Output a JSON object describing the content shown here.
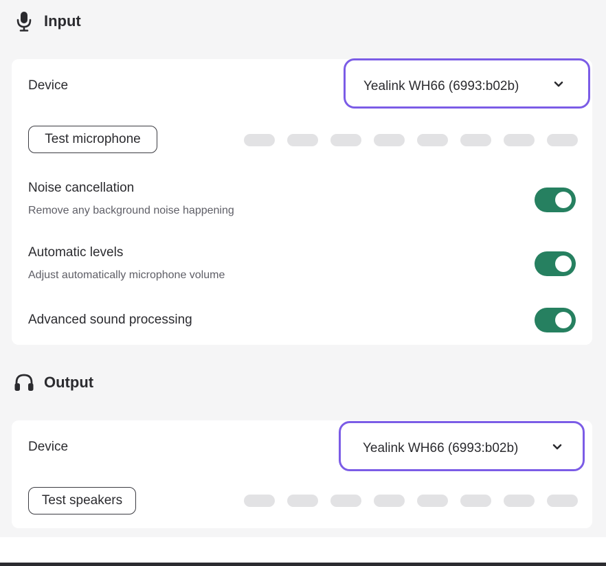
{
  "input": {
    "title": "Input",
    "icon": "microphone-icon",
    "device_label": "Device",
    "device_value": "Yealink WH66 (6993:b02b)",
    "test_button": "Test microphone",
    "level_segments": 8,
    "noise_cancellation": {
      "label": "Noise cancellation",
      "description": "Remove any background noise happening",
      "enabled": true
    },
    "automatic_levels": {
      "label": "Automatic levels",
      "description": "Adjust automatically microphone volume",
      "enabled": true
    },
    "advanced_sound": {
      "label": "Advanced sound processing",
      "enabled": true
    }
  },
  "output": {
    "title": "Output",
    "icon": "headphones-icon",
    "device_label": "Device",
    "device_value": "Yealink WH66 (6993:b02b)",
    "test_button": "Test speakers",
    "level_segments": 8
  },
  "colors": {
    "accent_border": "#7b5ce6",
    "toggle_on": "#268060",
    "meter_inactive": "#e2e2e4"
  }
}
